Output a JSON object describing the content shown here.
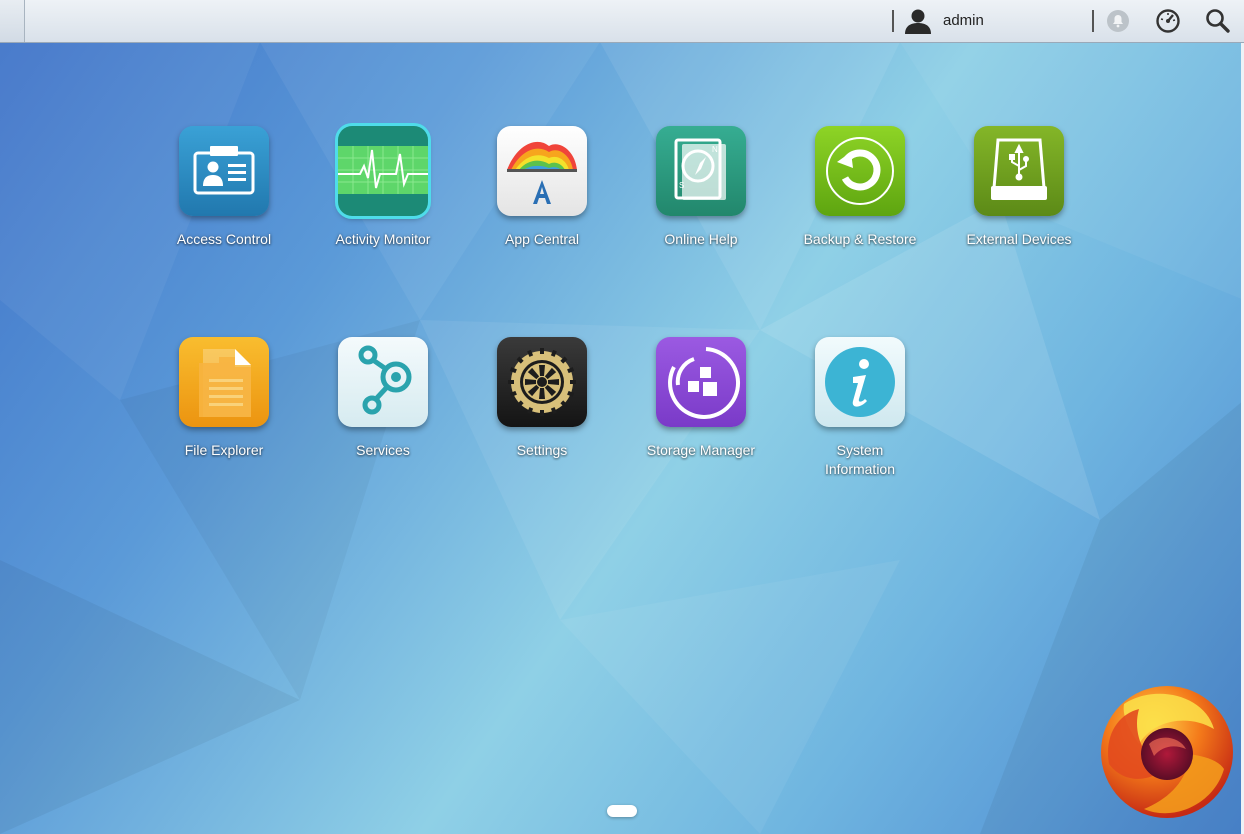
{
  "topbar": {
    "username": "admin",
    "icons": [
      "user-icon",
      "notification-bell-icon",
      "dashboard-gauge-icon",
      "search-icon"
    ]
  },
  "apps": [
    {
      "label": "Access Control",
      "icon": "id-card-icon",
      "color": "#2f8fc4"
    },
    {
      "label": "Activity Monitor",
      "icon": "heartbeat-monitor-icon",
      "color": "#1c8a76"
    },
    {
      "label": "App Central",
      "icon": "app-central-rainbow-icon",
      "color": "#f2f2f2"
    },
    {
      "label": "Online Help",
      "icon": "compass-book-icon",
      "color": "#2e9f84"
    },
    {
      "label": "Backup & Restore",
      "icon": "backup-circle-arrow-icon",
      "color": "#7cc21c"
    },
    {
      "label": "External Devices",
      "icon": "usb-drive-icon",
      "color": "#6e9e1e"
    },
    {
      "label": "File Explorer",
      "icon": "document-folder-icon",
      "color": "#f3a91d"
    },
    {
      "label": "Services",
      "icon": "services-node-icon",
      "color": "#e8f3f6"
    },
    {
      "label": "Settings",
      "icon": "gear-wheel-icon",
      "color": "#222222"
    },
    {
      "label": "Storage Manager",
      "icon": "storage-blocks-icon",
      "color": "#8a48d6"
    },
    {
      "label": "System\nInformation",
      "icon": "info-icon",
      "color": "#dff3f8"
    }
  ],
  "pager": {
    "current_page": 1
  }
}
